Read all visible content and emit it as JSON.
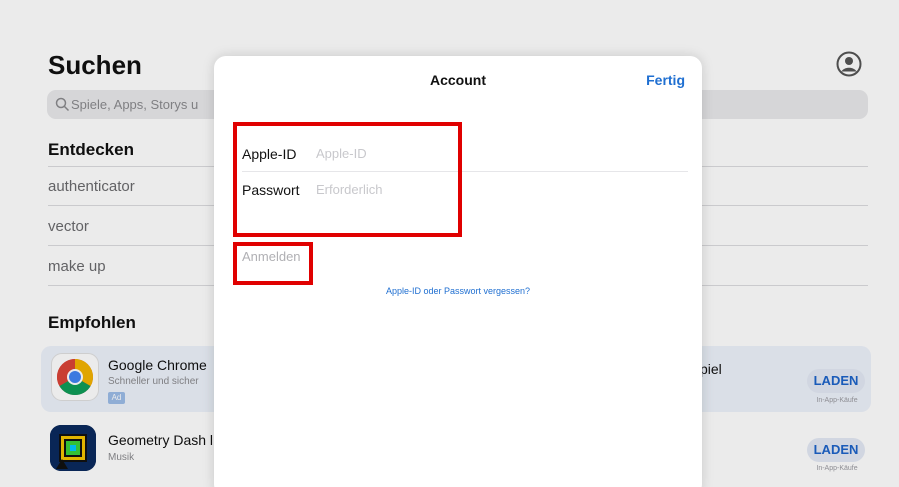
{
  "background": {
    "page_title": "Suchen",
    "search_placeholder": "Spiele, Apps, Storys u",
    "discover_heading": "Entdecken",
    "suggestions": [
      "authenticator",
      "vector",
      "make up"
    ],
    "recommended_heading": "Empfohlen",
    "apps": [
      {
        "name": "Google Chrome",
        "subtitle": "Schneller und sicher",
        "badge": "Ad",
        "button": "LADEN",
        "note": "In-App-Käufe",
        "icon": "chrome-icon"
      },
      {
        "name": "Geometry Dash l",
        "subtitle": "Musik",
        "button": "LADEN",
        "note": "In-App-Käufe",
        "icon": "geometry-dash-icon"
      }
    ],
    "partial_right_text": "piel",
    "avatar_icon": "account-circle-icon",
    "search_icon": "magnifier-icon"
  },
  "modal": {
    "title": "Account",
    "done_label": "Fertig",
    "apple_id_label": "Apple-ID",
    "apple_id_placeholder": "Apple-ID",
    "apple_id_value": "",
    "password_label": "Passwort",
    "password_placeholder": "Erforderlich",
    "password_value": "",
    "sign_in_label": "Anmelden",
    "forgot_link": "Apple-ID oder Passwort vergessen?"
  },
  "colors": {
    "accent": "#1f6fd1",
    "highlight_box": "#e00000"
  }
}
